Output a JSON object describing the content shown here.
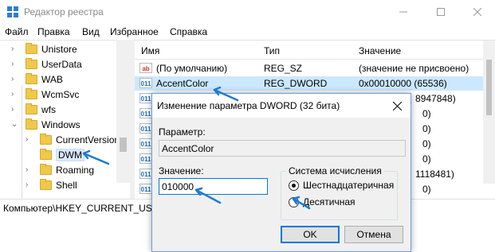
{
  "window": {
    "title": "Редактор реестра"
  },
  "menu": [
    "Файл",
    "Правка",
    "Вид",
    "Избранное",
    "Справка"
  ],
  "tree": {
    "items": [
      {
        "label": "Unistore"
      },
      {
        "label": "UserData"
      },
      {
        "label": "WAB"
      },
      {
        "label": "WcmSvc"
      },
      {
        "label": "wfs"
      },
      {
        "label": "Windows"
      },
      {
        "label": "CurrentVersion"
      },
      {
        "label": "DWM"
      },
      {
        "label": "Roaming"
      },
      {
        "label": "Shell"
      }
    ]
  },
  "list": {
    "columns": {
      "name": "Имя",
      "type": "Тип",
      "value": "Значение"
    },
    "rows": [
      {
        "name": "(По умолчанию)",
        "type": "REG_SZ",
        "value": "(значение не присвоено)",
        "icon": "ab"
      },
      {
        "name": "AccentColor",
        "type": "REG_DWORD",
        "value": "0x00010000 (65536)",
        "icon": "binary"
      }
    ],
    "partial_values": [
      "8947848)",
      "0)",
      "0)",
      "0)",
      "0)",
      "1118481)",
      "0)"
    ]
  },
  "status": {
    "path": "Компьютер\\HKEY_CURRENT_USER"
  },
  "dialog": {
    "title": "Изменение параметра DWORD (32 бита)",
    "param_label": "Параметр:",
    "param_value": "AccentColor",
    "value_label": "Значение:",
    "value": "010000",
    "base_legend": "Система исчисления",
    "base_options": [
      "Шестнадцатеричная",
      "Десятичная"
    ],
    "base_selected": "Шестнадцатеричная",
    "ok": "OK",
    "cancel": "Отмена"
  },
  "colors": {
    "selection": "#cce8ff",
    "annotation_arrow": "#1e7bd0",
    "dialog_border": "#6aa0e0"
  }
}
